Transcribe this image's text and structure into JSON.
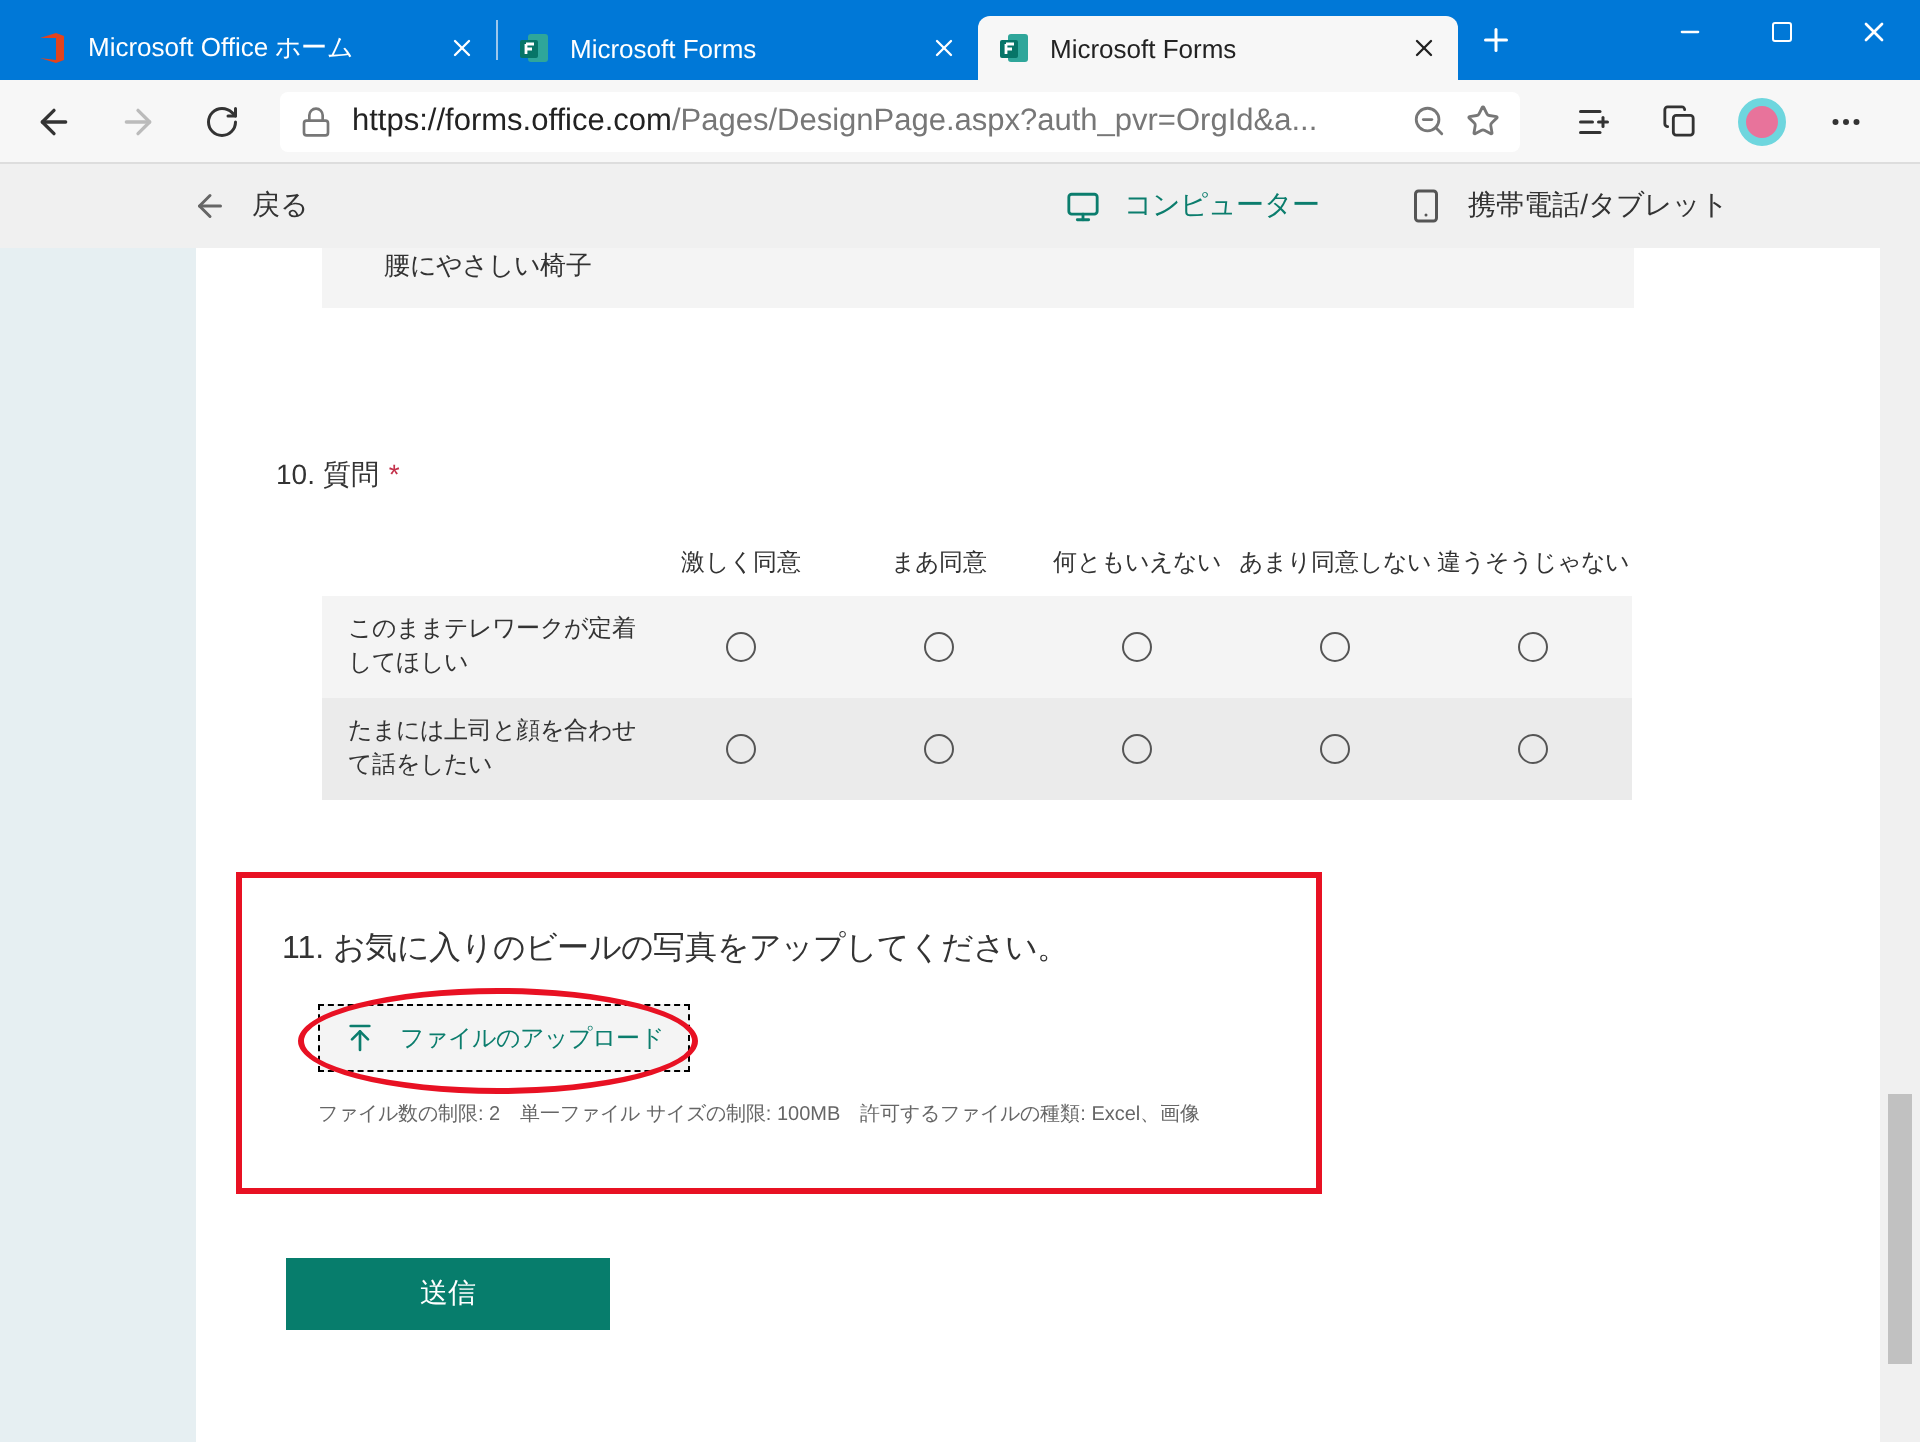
{
  "browser": {
    "tabs": [
      {
        "title": "Microsoft Office ホーム",
        "kind": "office",
        "selected": false
      },
      {
        "title": "Microsoft Forms",
        "kind": "forms",
        "selected": false
      },
      {
        "title": "Microsoft Forms",
        "kind": "forms",
        "selected": true
      }
    ],
    "url_host": "https://forms.office.com",
    "url_path": "/Pages/DesignPage.aspx?auth_pvr=OrgId&a..."
  },
  "forms_header": {
    "back": "戻る",
    "views": [
      {
        "label": "コンピューター",
        "kind": "monitor",
        "selected": true
      },
      {
        "label": "携帯電話/タブレット",
        "kind": "phone",
        "selected": false
      }
    ]
  },
  "previous_option": "腰にやさしい椅子",
  "question_10": {
    "number": "10.",
    "title": "質問",
    "required_mark": "*",
    "columns": [
      "激しく同意",
      "まあ同意",
      "何ともいえない",
      "あまり同意しない",
      "違うそうじゃない"
    ],
    "rows": [
      {
        "label": "このままテレワークが定着してほしい",
        "options": [
          {
            "selected": false
          },
          {
            "selected": false
          },
          {
            "selected": false
          },
          {
            "selected": false
          },
          {
            "selected": false
          }
        ]
      },
      {
        "label": "たまには上司と顔を合わせて話をしたい",
        "options": [
          {
            "selected": false
          },
          {
            "selected": false
          },
          {
            "selected": false
          },
          {
            "selected": false
          },
          {
            "selected": false
          }
        ]
      }
    ]
  },
  "question_11": {
    "number": "11.",
    "title": "お気に入りのビールの写真をアップしてください。",
    "highlighted": true,
    "upload_button": "ファイルのアップロード",
    "limits": "ファイル数の制限: 2　単一ファイル サイズの制限: 100MB　許可するファイルの種類: Excel、画像"
  },
  "submit": "送信"
}
